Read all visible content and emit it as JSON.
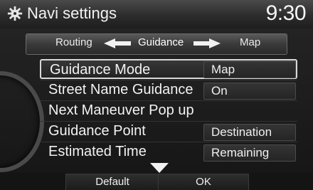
{
  "header": {
    "title": "Navi settings",
    "clock": "9:30"
  },
  "tabs": {
    "left": "Routing",
    "current": "Guidance",
    "right": "Map"
  },
  "rows": [
    {
      "label": "Guidance Mode",
      "value": "Map",
      "selected": true
    },
    {
      "label": "Street Name Guidance",
      "value": "On"
    },
    {
      "label": "Next Maneuver Pop up",
      "value": ""
    },
    {
      "label": "Guidance Point",
      "value": "Destination"
    },
    {
      "label": "Estimated Time",
      "value": "Remaining"
    }
  ],
  "buttons": {
    "default": "Default",
    "ok": "OK"
  },
  "icons": {
    "header": "gear-icon",
    "prev_tab": "arrow-left-icon",
    "next_tab": "arrow-right-icon",
    "scroll": "scroll-down-icon"
  }
}
